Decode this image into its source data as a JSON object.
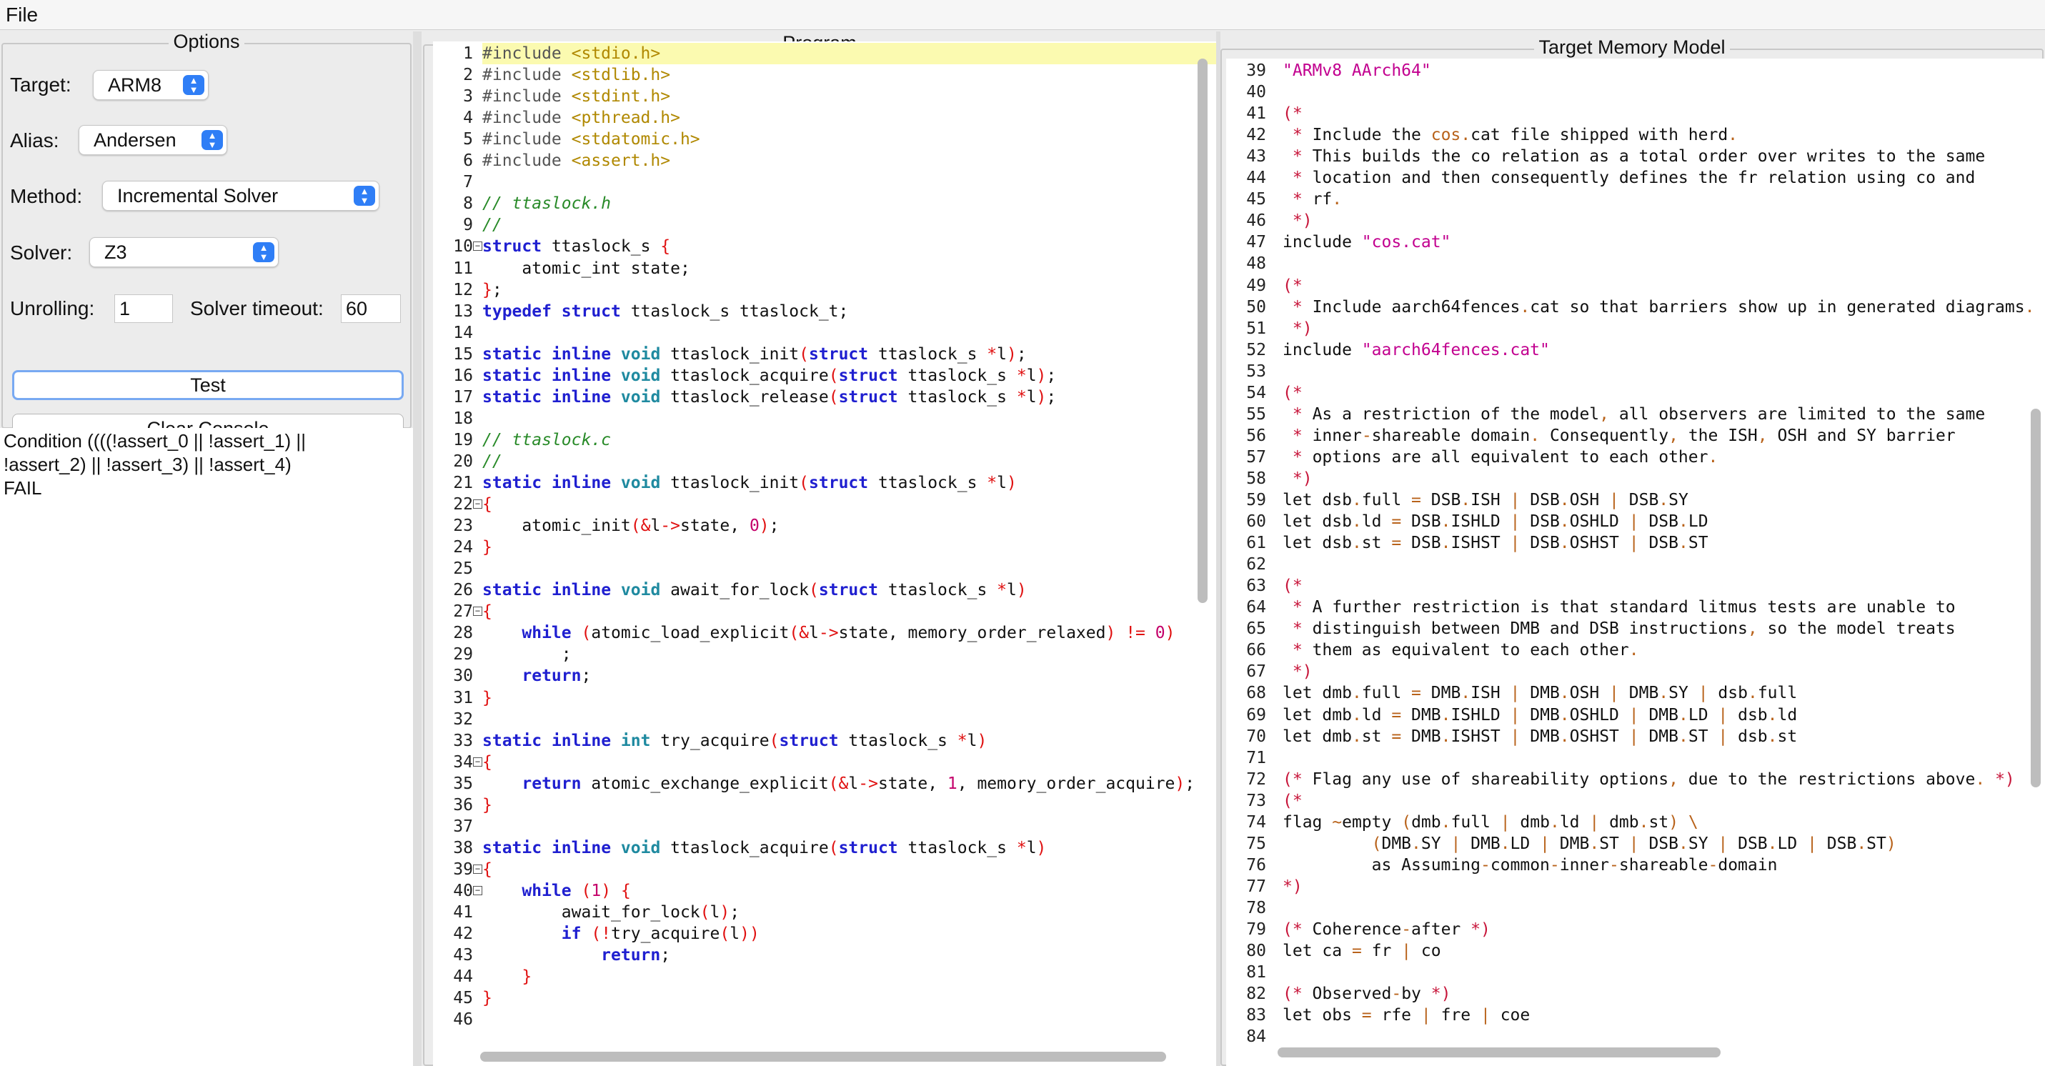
{
  "menubar": {
    "file": "File"
  },
  "options": {
    "title": "Options",
    "target_label": "Target:",
    "target_value": "ARM8",
    "alias_label": "Alias:",
    "alias_value": "Andersen",
    "method_label": "Method:",
    "method_value": "Incremental Solver",
    "solver_label": "Solver:",
    "solver_value": "Z3",
    "unrolling_label": "Unrolling:",
    "unrolling_value": "1",
    "timeout_label": "Solver timeout:",
    "timeout_value": "60",
    "test_button": "Test",
    "clear_button": "Clear Console"
  },
  "console": {
    "lines": [
      "Condition ((((!assert_0 || !assert_1) ||",
      "!assert_2) || !assert_3) || !assert_4)",
      "FAIL"
    ]
  },
  "program": {
    "title": "Program",
    "first_line": 1,
    "highlight_line": 1,
    "fold_lines": [
      10,
      22,
      27,
      34,
      39,
      40
    ],
    "lines": [
      "#include <stdio.h>",
      "#include <stdlib.h>",
      "#include <stdint.h>",
      "#include <pthread.h>",
      "#include <stdatomic.h>",
      "#include <assert.h>",
      "",
      "// ttaslock.h",
      "//",
      "struct ttaslock_s {",
      "    atomic_int state;",
      "};",
      "typedef struct ttaslock_s ttaslock_t;",
      "",
      "static inline void ttaslock_init(struct ttaslock_s *l);",
      "static inline void ttaslock_acquire(struct ttaslock_s *l);",
      "static inline void ttaslock_release(struct ttaslock_s *l);",
      "",
      "// ttaslock.c",
      "//",
      "static inline void ttaslock_init(struct ttaslock_s *l)",
      "{",
      "    atomic_init(&l->state, 0);",
      "}",
      "",
      "static inline void await_for_lock(struct ttaslock_s *l)",
      "{",
      "    while (atomic_load_explicit(&l->state, memory_order_relaxed) != 0)",
      "        ;",
      "    return;",
      "}",
      "",
      "static inline int try_acquire(struct ttaslock_s *l)",
      "{",
      "    return atomic_exchange_explicit(&l->state, 1, memory_order_acquire);",
      "}",
      "",
      "static inline void ttaslock_acquire(struct ttaslock_s *l)",
      "{",
      "    while (1) {",
      "        await_for_lock(l);",
      "        if (!try_acquire(l))",
      "            return;",
      "    }",
      "}",
      ""
    ]
  },
  "model": {
    "title": "Target Memory Model",
    "first_line": 39,
    "lines": [
      "\"ARMv8 AArch64\"",
      "",
      "(*",
      " * Include the cos.cat file shipped with herd.",
      " * This builds the co relation as a total order over writes to the same",
      " * location and then consequently defines the fr relation using co and",
      " * rf.",
      " *)",
      "include \"cos.cat\"",
      "",
      "(*",
      " * Include aarch64fences.cat so that barriers show up in generated diagrams.",
      " *)",
      "include \"aarch64fences.cat\"",
      "",
      "(*",
      " * As a restriction of the model, all observers are limited to the same",
      " * inner-shareable domain. Consequently, the ISH, OSH and SY barrier",
      " * options are all equivalent to each other.",
      " *)",
      "let dsb.full = DSB.ISH | DSB.OSH | DSB.SY",
      "let dsb.ld = DSB.ISHLD | DSB.OSHLD | DSB.LD",
      "let dsb.st = DSB.ISHST | DSB.OSHST | DSB.ST",
      "",
      "(*",
      " * A further restriction is that standard litmus tests are unable to",
      " * distinguish between DMB and DSB instructions, so the model treats",
      " * them as equivalent to each other.",
      " *)",
      "let dmb.full = DMB.ISH | DMB.OSH | DMB.SY | dsb.full",
      "let dmb.ld = DMB.ISHLD | DMB.OSHLD | DMB.LD | dsb.ld",
      "let dmb.st = DMB.ISHST | DMB.OSHST | DMB.ST | dsb.st",
      "",
      "(* Flag any use of shareability options, due to the restrictions above. *)",
      "(*",
      "flag ~empty (dmb.full | dmb.ld | dmb.st) \\",
      "         (DMB.SY | DMB.LD | DMB.ST | DSB.SY | DSB.LD | DSB.ST)",
      "         as Assuming-common-inner-shareable-domain",
      "*)",
      "",
      "(* Coherence-after *)",
      "let ca = fr | co",
      "",
      "(* Observed-by *)",
      "let obs = rfe | fre | coe",
      ""
    ]
  }
}
